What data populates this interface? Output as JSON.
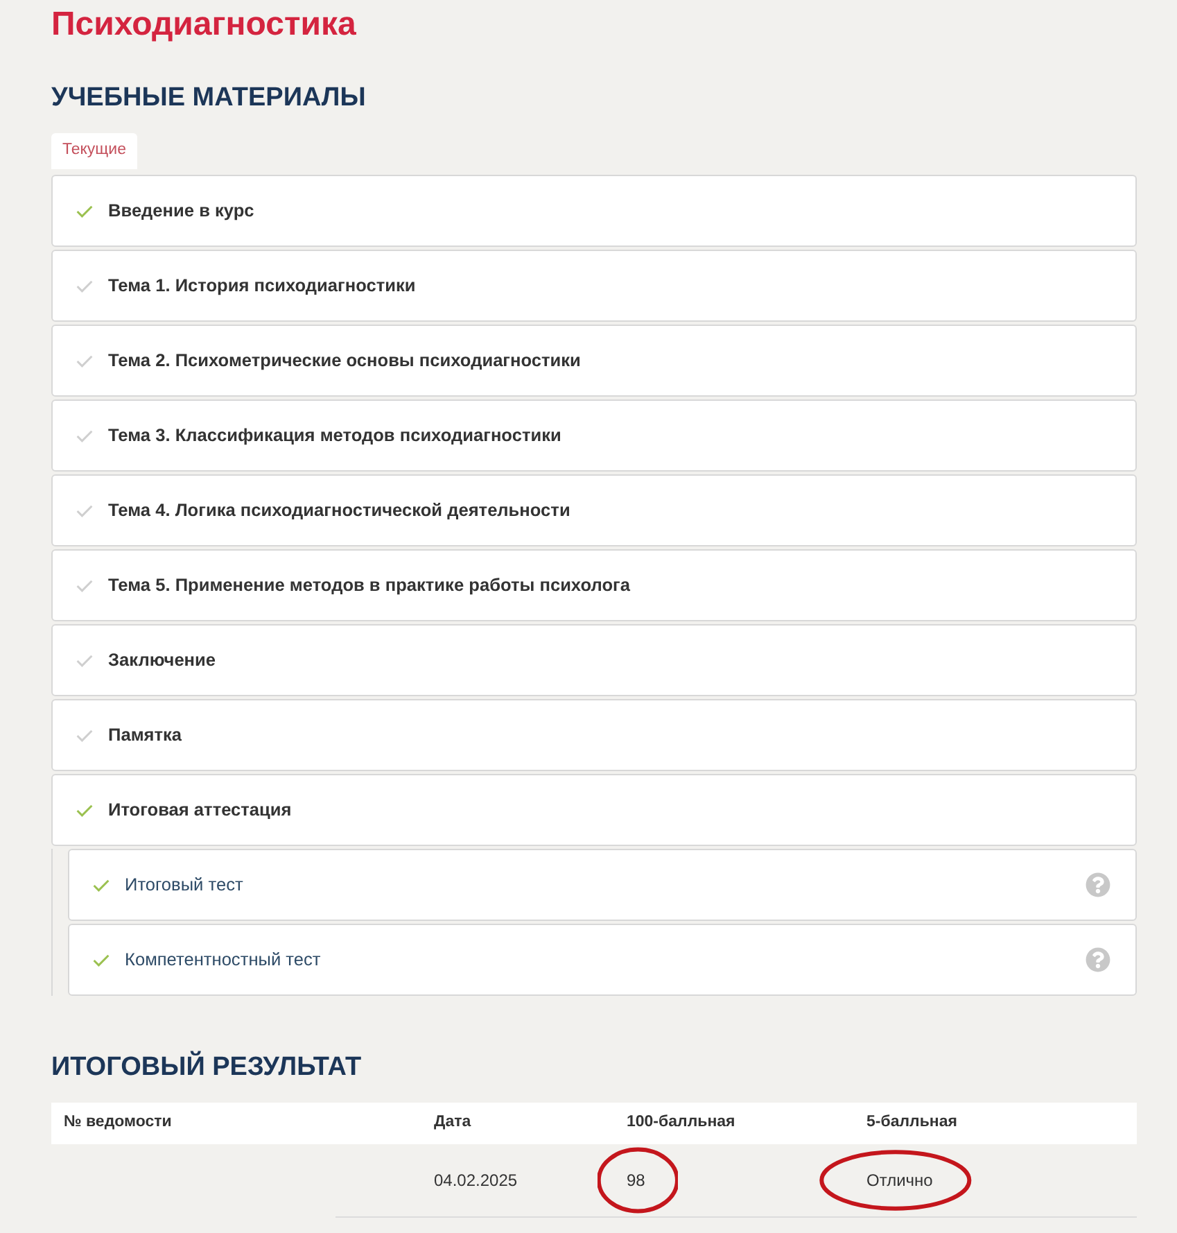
{
  "page_title": "Психодиагностика",
  "materials": {
    "heading": "УЧЕБНЫЕ МАТЕРИАЛЫ",
    "tabs": [
      {
        "label": "Текущие",
        "selected": true
      }
    ],
    "items": [
      {
        "label": "Введение в курс",
        "done": true
      },
      {
        "label": "Тема 1. История психодиагностики",
        "done": false
      },
      {
        "label": "Тема 2. Психометрические основы психодиагностики",
        "done": false
      },
      {
        "label": "Тема 3. Классификация методов психодиагностики",
        "done": false
      },
      {
        "label": "Тема 4. Логика психодиагностической деятельности",
        "done": false
      },
      {
        "label": "Тема 5. Применение методов в практике работы психолога",
        "done": false
      },
      {
        "label": "Заключение",
        "done": false
      },
      {
        "label": "Памятка",
        "done": false
      },
      {
        "label": "Итоговая аттестация",
        "done": true,
        "expanded": true,
        "children": [
          {
            "label": "Итоговый тест",
            "done": true
          },
          {
            "label": "Компетентностный тест",
            "done": true
          }
        ]
      }
    ]
  },
  "result": {
    "heading": "ИТОГОВЫЙ РЕЗУЛЬТАТ",
    "columns": [
      "№ ведомости",
      "Дата",
      "100-балльная",
      "5-балльная"
    ],
    "rows": [
      {
        "date": {
          "text": "04.02.2025",
          "circled": false
        },
        "score_100": {
          "text": "98",
          "circled": true
        },
        "score_5": {
          "text": "Отлично",
          "circled": true
        }
      }
    ]
  }
}
